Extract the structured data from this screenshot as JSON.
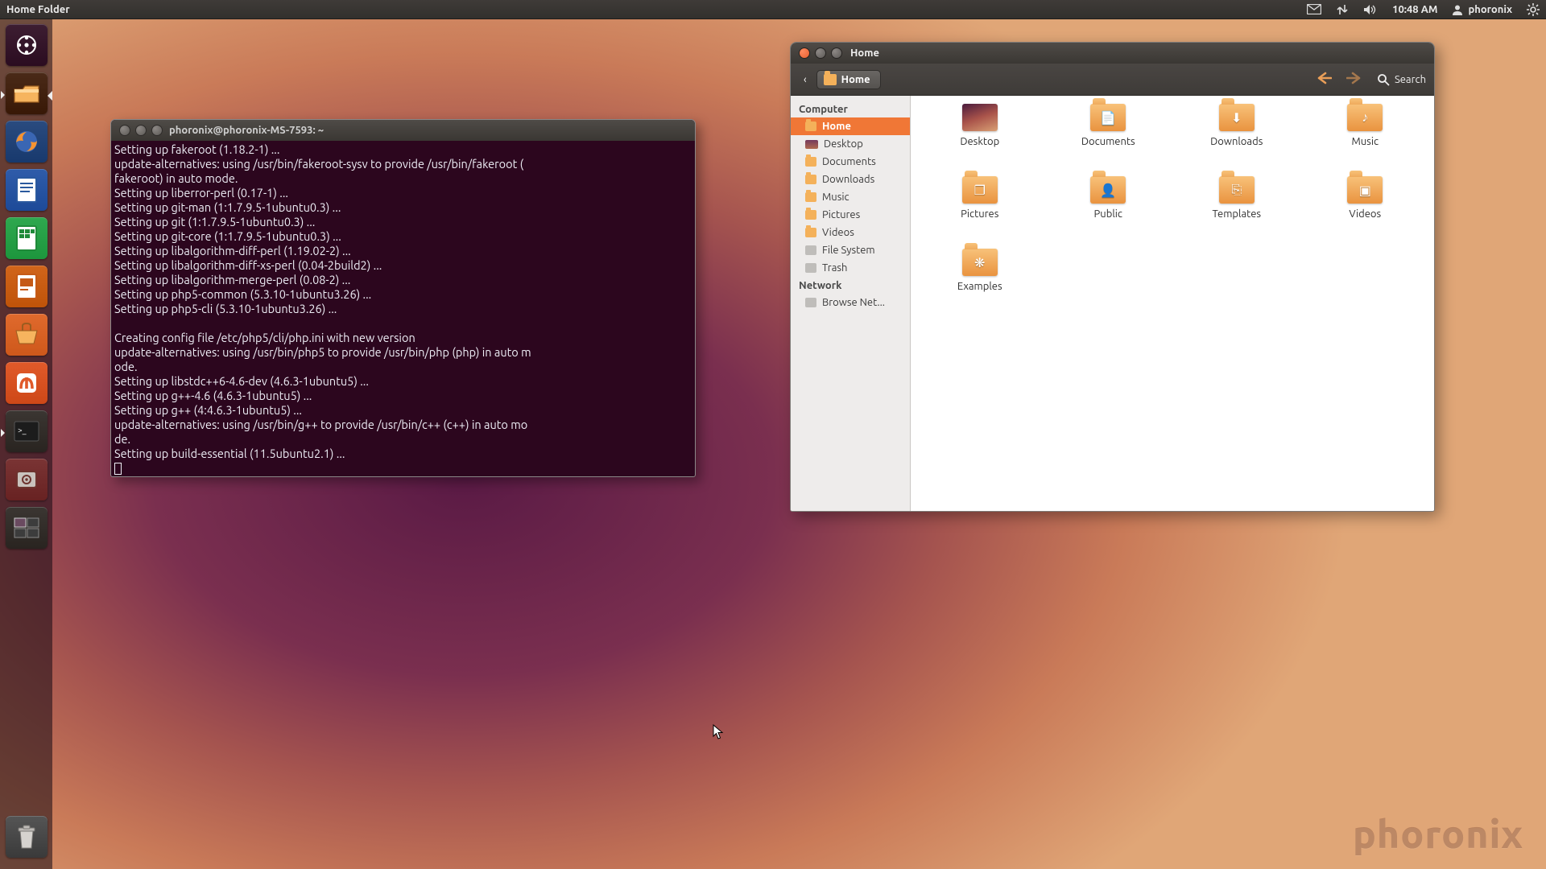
{
  "panel": {
    "app_title": "Home Folder",
    "time": "10:48 AM",
    "user": "phoronix"
  },
  "launcher": {
    "items": [
      {
        "name": "dash",
        "bg": "#3d1e32",
        "title": "Dash"
      },
      {
        "name": "nautilus",
        "bg": "#4a2a18",
        "title": "Files",
        "active_right": true,
        "pip": true
      },
      {
        "name": "firefox",
        "bg": "#2a4b7f",
        "title": "Firefox"
      },
      {
        "name": "writer",
        "bg": "#2f5caa",
        "title": "LibreOffice Writer"
      },
      {
        "name": "calc",
        "bg": "#2fa84f",
        "title": "LibreOffice Calc"
      },
      {
        "name": "impress",
        "bg": "#d1651b",
        "title": "LibreOffice Impress"
      },
      {
        "name": "software-center",
        "bg": "#e06a2d",
        "title": "Ubuntu Software Center"
      },
      {
        "name": "ubuntu-one",
        "bg": "#e05a2a",
        "title": "Ubuntu One"
      },
      {
        "name": "terminal",
        "bg": "#3b3632",
        "title": "Terminal",
        "pip": true
      },
      {
        "name": "settings",
        "bg": "#7a3434",
        "title": "System Settings"
      },
      {
        "name": "workspace",
        "bg": "#3b3632",
        "title": "Workspace Switcher"
      }
    ]
  },
  "terminal": {
    "title": "phoronix@phoronix-MS-7593: ~",
    "lines": [
      "Setting up fakeroot (1.18.2-1) ...",
      "update-alternatives: using /usr/bin/fakeroot-sysv to provide /usr/bin/fakeroot (",
      "fakeroot) in auto mode.",
      "Setting up liberror-perl (0.17-1) ...",
      "Setting up git-man (1:1.7.9.5-1ubuntu0.3) ...",
      "Setting up git (1:1.7.9.5-1ubuntu0.3) ...",
      "Setting up git-core (1:1.7.9.5-1ubuntu0.3) ...",
      "Setting up libalgorithm-diff-perl (1.19.02-2) ...",
      "Setting up libalgorithm-diff-xs-perl (0.04-2build2) ...",
      "Setting up libalgorithm-merge-perl (0.08-2) ...",
      "Setting up php5-common (5.3.10-1ubuntu3.26) ...",
      "Setting up php5-cli (5.3.10-1ubuntu3.26) ...",
      "",
      "Creating config file /etc/php5/cli/php.ini with new version",
      "update-alternatives: using /usr/bin/php5 to provide /usr/bin/php (php) in auto m",
      "ode.",
      "Setting up libstdc++6-4.6-dev (4.6.3-1ubuntu5) ...",
      "Setting up g++-4.6 (4.6.3-1ubuntu5) ...",
      "Setting up g++ (4:4.6.3-1ubuntu5) ...",
      "update-alternatives: using /usr/bin/g++ to provide /usr/bin/c++ (c++) in auto mo",
      "de.",
      "Setting up build-essential (11.5ubuntu2.1) ..."
    ]
  },
  "nautilus": {
    "title": "Home",
    "crumb_root": "‹",
    "path_label": "Home",
    "search_label": "Search",
    "sidebar": {
      "computer_header": "Computer",
      "network_header": "Network",
      "items_computer": [
        {
          "label": "Home",
          "icon": "folder",
          "active": true
        },
        {
          "label": "Desktop",
          "icon": "desktop-ic"
        },
        {
          "label": "Documents",
          "icon": "folder"
        },
        {
          "label": "Downloads",
          "icon": "folder"
        },
        {
          "label": "Music",
          "icon": "folder"
        },
        {
          "label": "Pictures",
          "icon": "folder"
        },
        {
          "label": "Videos",
          "icon": "folder"
        },
        {
          "label": "File System",
          "icon": "fs-ic"
        },
        {
          "label": "Trash",
          "icon": "trash-ic"
        }
      ],
      "items_network": [
        {
          "label": "Browse Net...",
          "icon": "net-ic"
        }
      ]
    },
    "files": [
      {
        "label": "Desktop",
        "icon": "desktop"
      },
      {
        "label": "Documents",
        "icon": "doc"
      },
      {
        "label": "Downloads",
        "icon": "down"
      },
      {
        "label": "Music",
        "icon": "music"
      },
      {
        "label": "Pictures",
        "icon": "pic"
      },
      {
        "label": "Public",
        "icon": "pub"
      },
      {
        "label": "Templates",
        "icon": "tmpl"
      },
      {
        "label": "Videos",
        "icon": "vid"
      },
      {
        "label": "Examples",
        "icon": "ex"
      }
    ]
  },
  "watermark": "phoronix"
}
